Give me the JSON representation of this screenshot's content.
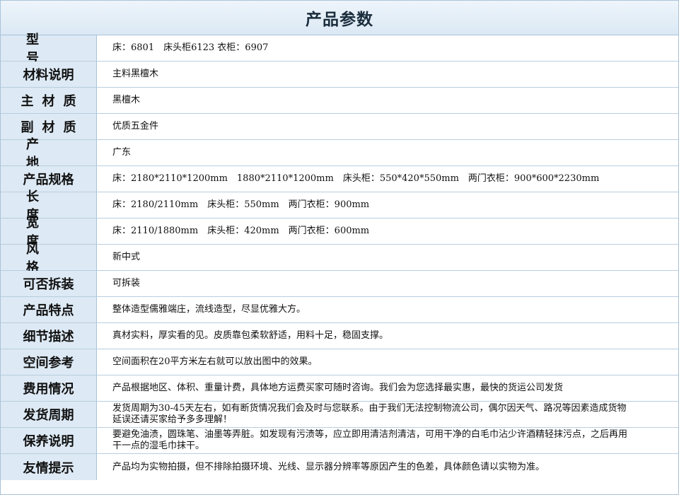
{
  "title": "产品参数",
  "rows": [
    {
      "label": "型号",
      "value": "床：6801　床头柜6123 衣柜：6907"
    },
    {
      "label": "材料说明",
      "value": "主料黑檀木"
    },
    {
      "label": "主材质",
      "value": "黑檀木"
    },
    {
      "label": "副材质",
      "value": "优质五金件"
    },
    {
      "label": "产地",
      "value": "广东"
    },
    {
      "label": "产品规格",
      "value": "床：2180*2110*1200mm　1880*2110*1200mm　床头柜：550*420*550mm　两门衣柜：900*600*2230mm"
    },
    {
      "label": "长度",
      "value": "床：2180/2110mm　床头柜：550mm　两门衣柜：900mm"
    },
    {
      "label": "宽度",
      "value": "床：2110/1880mm　床头柜：420mm　两门衣柜：600mm"
    },
    {
      "label": "风格",
      "value": "新中式"
    },
    {
      "label": "可否拆装",
      "value": "可拆装"
    },
    {
      "label": "产品特点",
      "value": "整体造型儒雅端庄，流线造型，尽显优雅大方。"
    },
    {
      "label": "细节描述",
      "value": "真材实料，厚实看的见。皮质靠包柔软舒适，用料十足，稳固支撑。"
    },
    {
      "label": "空间参考",
      "value": "空间面积在20平方米左右就可以放出图中的效果。"
    },
    {
      "label": "费用情况",
      "value": "产品根据地区、体积、重量计费，具体地方运费买家可随时咨询。我们会为您选择最实惠，最快的货运公司发货"
    },
    {
      "label": "发货周期",
      "value": "发货周期为30-45天左右，如有断货情况我们会及时与您联系。由于我们无法控制物流公司，偶尔因天气、路况等因素造成货物延误还请买家给予多多理解！"
    },
    {
      "label": "保养说明",
      "value": "要避免油渍，圆珠笔、油墨等弄脏。如发现有污渍等，应立即用清洁剂清洁，可用干净的白毛巾沾少许酒精轻抹污点，之后再用干一点的湿毛巾抹干。"
    },
    {
      "label": "友情提示",
      "value": "产品均为实物拍摄，但不排除拍摄环境、光线、显示器分辨率等原因产生的色差，具体颜色请以实物为准。"
    }
  ]
}
